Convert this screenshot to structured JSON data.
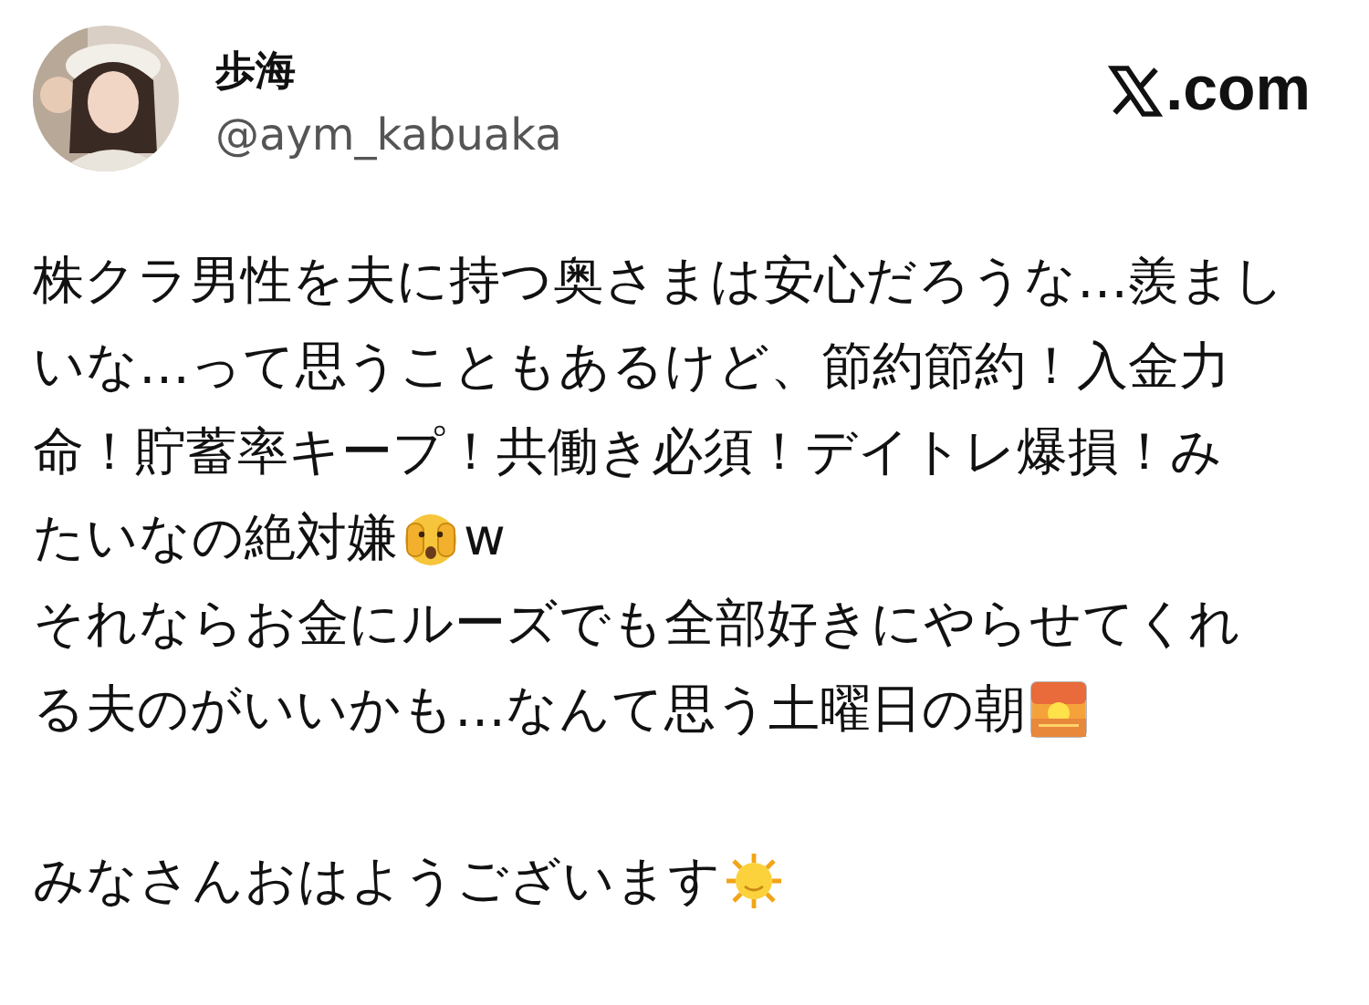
{
  "author": {
    "name": "歩海",
    "handle": "@aym_kabuaka"
  },
  "source": {
    "domain": ".com"
  },
  "paragraphs": [
    {
      "lines": [
        [
          {
            "kind": "text",
            "text": "株クラ男性を夫に持つ奥さまは安心だろうな…羨まし"
          }
        ],
        [
          {
            "kind": "text",
            "text": "いな…って思うこともあるけど、節約節約！入金力"
          }
        ],
        [
          {
            "kind": "text",
            "text": "命！貯蓄率キープ！共働き必須！デイトレ爆損！み"
          }
        ],
        [
          {
            "kind": "text",
            "text": "たいなの絶対嫌"
          },
          {
            "kind": "peek"
          },
          {
            "kind": "text",
            "text": "w"
          }
        ]
      ]
    },
    {
      "lines": [
        [
          {
            "kind": "text",
            "text": "それならお金にルーズでも全部好きにやらせてくれ"
          }
        ],
        [
          {
            "kind": "text",
            "text": "る夫のがいいかも…なんて思う土曜日の朝"
          },
          {
            "kind": "sunrise"
          }
        ]
      ]
    },
    {
      "lines": [
        [
          {
            "kind": "text",
            "text": "みなさんおはようございます"
          },
          {
            "kind": "sun"
          }
        ]
      ]
    }
  ]
}
